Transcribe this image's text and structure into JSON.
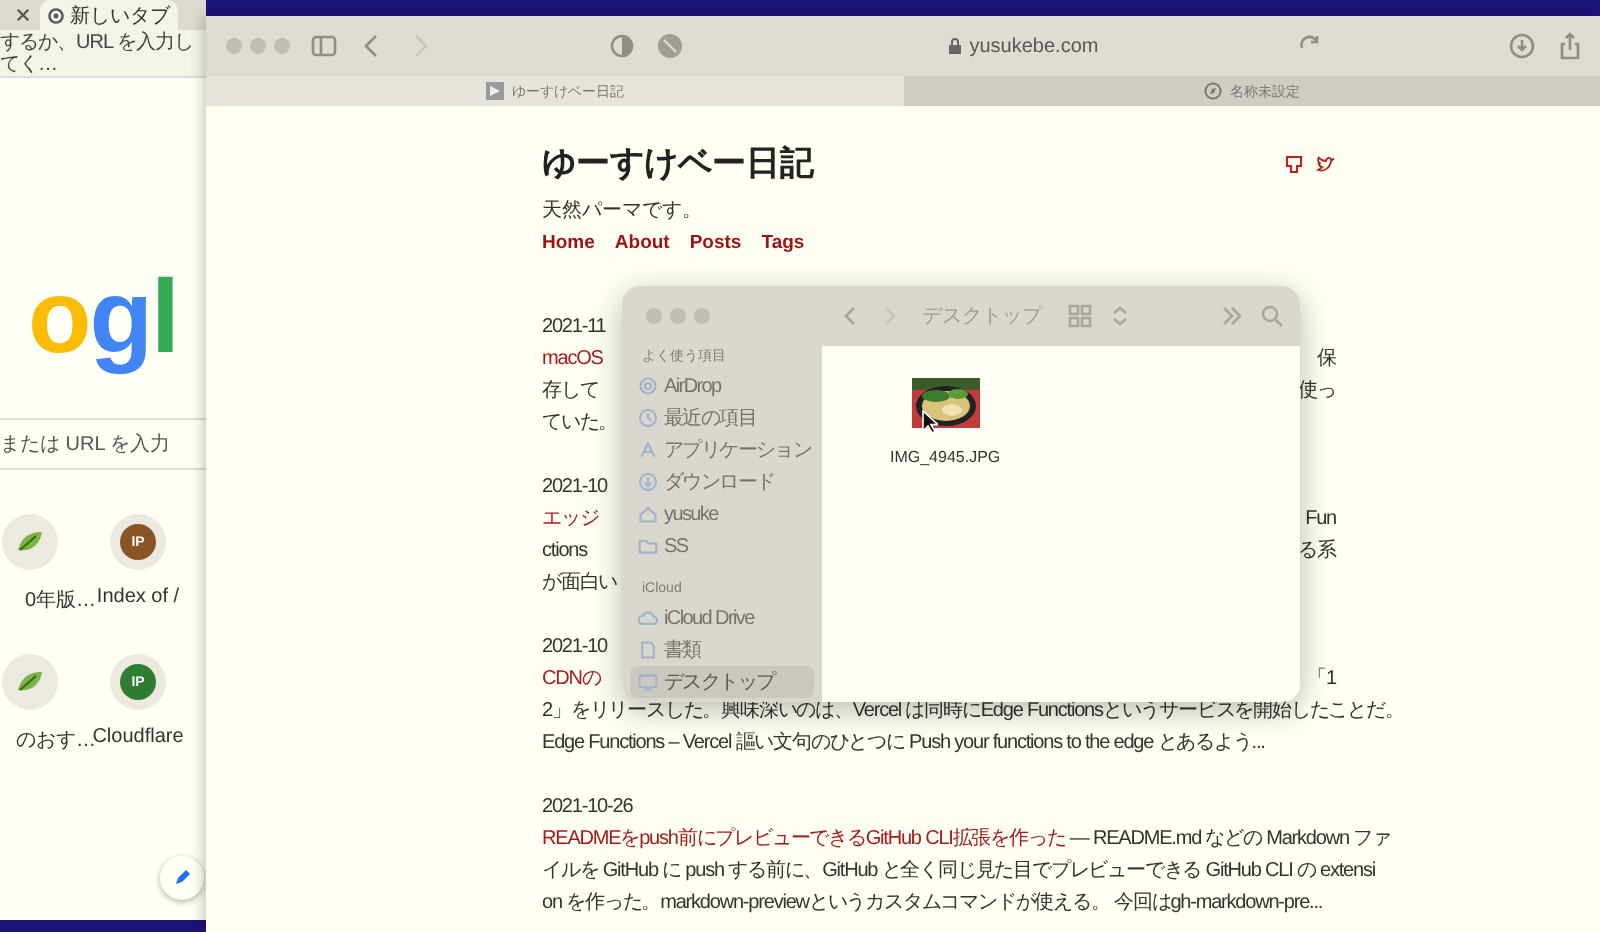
{
  "chrome_window": {
    "tabs": [
      {
        "label": "新しいタブ",
        "selected": true
      }
    ],
    "address": {
      "value": "するか、URL を入力してく…"
    },
    "logo": "ogl",
    "search": {
      "placeholder": "または URL を入力"
    },
    "shortcuts": [
      {
        "label": "0年版…",
        "kind": "site"
      },
      {
        "label": "Index of /",
        "kind": "initials",
        "initials": "IP",
        "color": "#8a5524"
      },
      {
        "label": "のおす…",
        "kind": "site"
      },
      {
        "label": "Cloudflare",
        "kind": "initials",
        "initials": "IP",
        "color": "#2e7d32"
      }
    ]
  },
  "safari_window": {
    "address": "yusukebe.com",
    "tabs": [
      {
        "label": "ゆーすけベー日記",
        "selected": true
      },
      {
        "label": "名称未設定",
        "selected": false
      }
    ]
  },
  "blog": {
    "title": "ゆーすけベー日記",
    "tagline": "天然パーマです。",
    "nav": [
      "Home",
      "About",
      "Posts",
      "Tags"
    ],
    "posts": [
      {
        "lines": [
          {
            "left": [
              {
                "text": "2021-11",
                "link": false
              }
            ]
          },
          {
            "left": [
              {
                "text": "macOS",
                "link": true
              }
            ],
            "right": [
              {
                "text": "保",
                "link": false
              }
            ]
          },
          {
            "left": [
              {
                "text": "存して",
                "link": false
              }
            ],
            "right": [
              {
                "text": "使っ",
                "link": false
              }
            ]
          },
          {
            "left": [
              {
                "text": "ていた。",
                "link": false
              }
            ]
          }
        ]
      },
      {
        "lines": [
          {
            "left": [
              {
                "text": "2021-10",
                "link": false
              }
            ]
          },
          {
            "left": [
              {
                "text": "エッジ",
                "link": true
              }
            ],
            "right": [
              {
                "text": "Fun",
                "link": false
              }
            ]
          },
          {
            "left": [
              {
                "text": "ctions",
                "link": false
              }
            ],
            "right": [
              {
                "text": "る系",
                "link": false
              }
            ]
          },
          {
            "left": [
              {
                "text": "が面白い",
                "link": false
              }
            ]
          }
        ]
      },
      {
        "lines": [
          {
            "left": [
              {
                "text": "2021-10",
                "link": false
              }
            ]
          },
          {
            "left": [
              {
                "text": "CDNの",
                "link": true
              }
            ],
            "right": [
              {
                "text": "「1",
                "link": false
              }
            ]
          },
          {
            "left": [
              {
                "text": "2」をリリースした。興味深いのは、Vercel は同時にEdge Functionsというサービスを開始したことだ。",
                "link": false
              }
            ]
          },
          {
            "left": [
              {
                "text": "Edge Functions – Vercel 謳い文句のひとつに Push your functions to the edge とあるよう...",
                "link": false
              }
            ]
          }
        ]
      },
      {
        "lines": [
          {
            "left": [
              {
                "text": "2021-10-26",
                "link": false
              }
            ]
          },
          {
            "left": [
              {
                "text": "READMEをpush前にプレビューできるGitHub CLI拡張を作った",
                "link": true
              },
              {
                "text": " — README.md などの Markdown ファ",
                "link": false
              }
            ]
          },
          {
            "left": [
              {
                "text": "イルを GitHub に push する前に、GitHub と全く同じ見た目でプレビューできる GitHub CLI の extensi",
                "link": false
              }
            ]
          },
          {
            "left": [
              {
                "text": "on を作った。markdown-previewというカスタムコマンドが使える。 今回はgh-markdown-pre...",
                "link": false
              }
            ]
          }
        ]
      }
    ]
  },
  "finder_window": {
    "title": "デスクトップ",
    "sidebar": [
      {
        "heading": "よく使う項目",
        "items": [
          {
            "label": "AirDrop",
            "selected": false
          },
          {
            "label": "最近の項目",
            "selected": false
          },
          {
            "label": "アプリケーション",
            "selected": false
          },
          {
            "label": "ダウンロード",
            "selected": false
          },
          {
            "label": "yusuke",
            "selected": false
          },
          {
            "label": "SS",
            "selected": false
          }
        ]
      },
      {
        "heading": "iCloud",
        "items": [
          {
            "label": "iCloud Drive",
            "selected": false
          },
          {
            "label": "書類",
            "selected": false
          },
          {
            "label": "デスクトップ",
            "selected": true
          }
        ]
      }
    ],
    "files": [
      {
        "name": "IMG_4945.JPG"
      }
    ]
  }
}
